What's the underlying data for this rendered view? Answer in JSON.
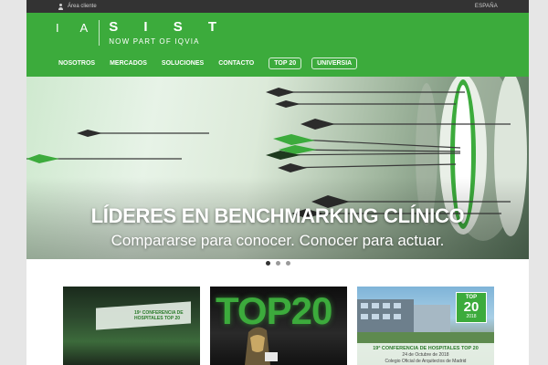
{
  "topbar": {
    "client_label": "Área cliente",
    "country_label": "ESPAÑA"
  },
  "logo": {
    "left": "I A",
    "right": "S I S T",
    "tagline": "NOW PART OF IQVIA"
  },
  "nav": {
    "items": [
      "NOSOTROS",
      "MERCADOS",
      "SOLUCIONES",
      "CONTACTO",
      "TOP 20",
      "UNIVERSIA"
    ]
  },
  "hero": {
    "title": "LÍDERES EN BENCHMARKING CLÍNICO",
    "subtitle": "Compararse para conocer. Conocer para actuar.",
    "slides_count": 3,
    "active_slide": 1
  },
  "cards": {
    "card1": {
      "screen_text": "19ª CONFERENCIA DE HOSPITALES TOP 20"
    },
    "card2": {
      "title": "TOP20"
    },
    "card3": {
      "badge_top": "TOP",
      "badge_number": "20",
      "badge_year": "2018",
      "banner_line1": "19ª CONFERENCIA DE HOSPITALES TOP 20",
      "banner_line2": "24 de Octubre de 2018",
      "banner_line3": "Colegio Oficial de Arquitectos de Madrid"
    }
  },
  "colors": {
    "brand_green": "#3cab3c",
    "topbar": "#333333"
  }
}
